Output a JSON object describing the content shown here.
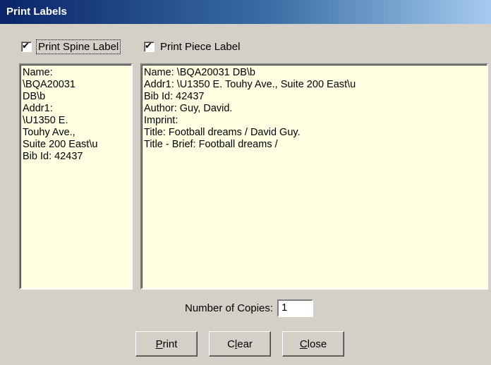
{
  "window": {
    "title": "Print Labels"
  },
  "spine": {
    "checkbox_label": "Print Spine Label",
    "checked": true,
    "text": "Name:\n\\BQA20031\nDB\\b\nAddr1:\n\\U1350 E.\nTouhy Ave.,\nSuite 200 East\\u\nBib Id: 42437"
  },
  "piece": {
    "checkbox_label": "Print Piece Label",
    "checked": true,
    "text": "Name: \\BQA20031 DB\\b\nAddr1: \\U1350 E. Touhy Ave., Suite 200 East\\u\nBib Id: 42437\nAuthor: Guy, David.\nImprint:\nTitle: Football dreams / David Guy.\nTitle - Brief: Football dreams /"
  },
  "copies": {
    "label": "Number of Copies:",
    "value": "1"
  },
  "buttons": {
    "print": {
      "mnemonic": "P",
      "rest": "rint"
    },
    "clear": {
      "pre": "C",
      "mnemonic": "l",
      "rest": "ear"
    },
    "close": {
      "mnemonic": "C",
      "rest": "lose"
    }
  },
  "icons": {
    "checkmark": "checkmark-icon"
  }
}
